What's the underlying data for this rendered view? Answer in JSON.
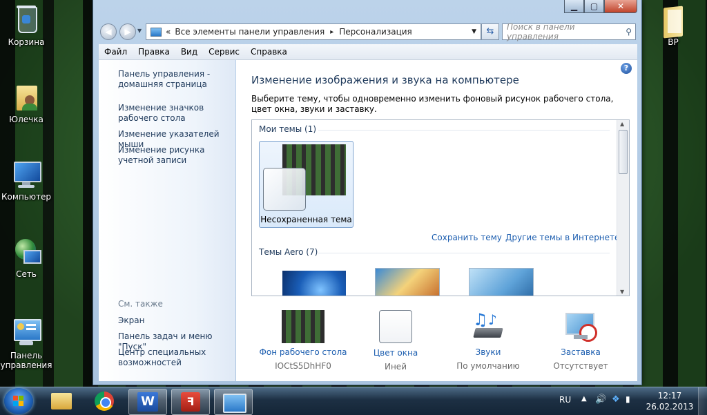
{
  "desktop": {
    "icons_left": [
      {
        "label": "Корзина",
        "icon": "recycle-bin-icon"
      },
      {
        "label": "Юлечка",
        "icon": "user-folder-icon"
      },
      {
        "label": "Компьютер",
        "icon": "computer-icon"
      },
      {
        "label": "Сеть",
        "icon": "network-icon"
      },
      {
        "label": "Панель управления",
        "icon": "control-panel-icon"
      }
    ],
    "icons_right": [
      {
        "label": "ВР",
        "icon": "folder-icon"
      }
    ]
  },
  "window": {
    "nav": {
      "breadcrumb_prefix": "«",
      "breadcrumb_1": "Все элементы панели управления",
      "breadcrumb_sep": "▸",
      "breadcrumb_2": "Персонализация",
      "search_placeholder": "Поиск в панели управления"
    },
    "menu": [
      "Файл",
      "Правка",
      "Вид",
      "Сервис",
      "Справка"
    ],
    "left_pane": {
      "home_link": "Панель управления - домашняя страница",
      "links": [
        "Изменение значков рабочего стола",
        "Изменение указателей мыши",
        "Изменение рисунка учетной записи"
      ],
      "see_also_title": "См. также",
      "see_also": [
        "Экран",
        "Панель задач и меню \"Пуск\"",
        "Центр специальных возможностей"
      ]
    },
    "main": {
      "title": "Изменение изображения и звука на компьютере",
      "description": "Выберите тему, чтобы одновременно изменить фоновый рисунок рабочего стола, цвет окна, звуки и заставку.",
      "my_themes": "Мои темы (1)",
      "selected_theme": "Несохраненная тема",
      "save_theme": "Сохранить тему",
      "more_themes": "Другие темы в Интернете",
      "aero_themes": "Темы Aero (7)",
      "bottom": [
        {
          "link": "Фон рабочего стола",
          "sub": "IOCtS5DhHF0"
        },
        {
          "link": "Цвет окна",
          "sub": "Иней"
        },
        {
          "link": "Звуки",
          "sub": "По умолчанию"
        },
        {
          "link": "Заставка",
          "sub": "Отсутствует"
        }
      ]
    }
  },
  "taskbar": {
    "lang": "RU",
    "time": "12:17",
    "date": "26.02.2013",
    "apps": [
      "explorer-icon",
      "chrome-icon",
      "word-icon",
      "pdf-icon",
      "control-panel-icon"
    ]
  },
  "colors": {
    "link": "#1e5fb0",
    "title": "#1e395b"
  }
}
